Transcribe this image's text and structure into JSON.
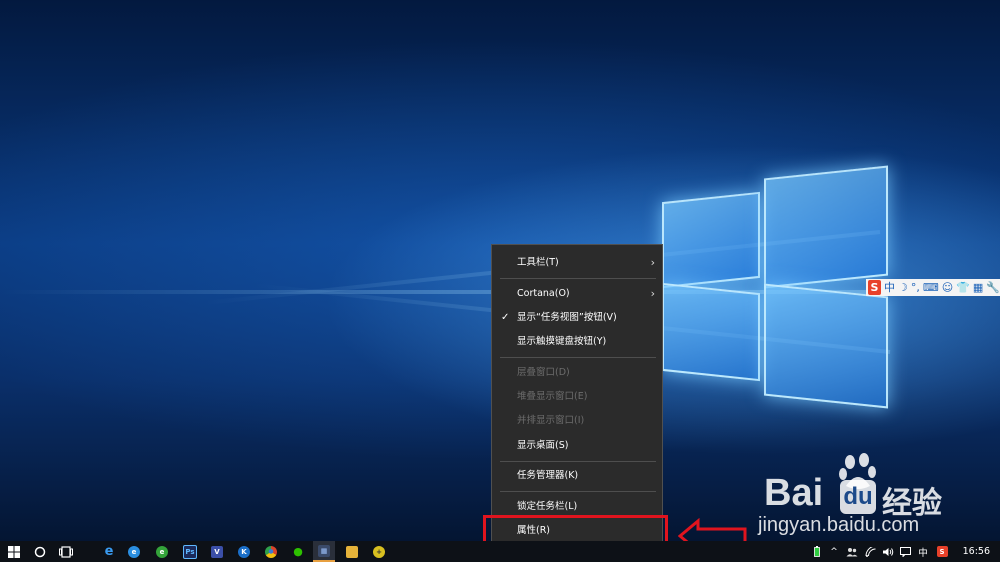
{
  "context_menu": {
    "items": [
      {
        "label": "工具栏(T)",
        "submenu": true,
        "enabled": true,
        "checked": false
      },
      {
        "label": "Cortana(O)",
        "submenu": true,
        "enabled": true,
        "checked": false
      },
      {
        "label": "显示“任务视图”按钮(V)",
        "submenu": false,
        "enabled": true,
        "checked": true
      },
      {
        "label": "显示触摸键盘按钮(Y)",
        "submenu": false,
        "enabled": true,
        "checked": false
      },
      {
        "label": "层叠窗口(D)",
        "submenu": false,
        "enabled": false,
        "checked": false
      },
      {
        "label": "堆叠显示窗口(E)",
        "submenu": false,
        "enabled": false,
        "checked": false
      },
      {
        "label": "并排显示窗口(I)",
        "submenu": false,
        "enabled": false,
        "checked": false
      },
      {
        "label": "显示桌面(S)",
        "submenu": false,
        "enabled": true,
        "checked": false
      },
      {
        "label": "任务管理器(K)",
        "submenu": false,
        "enabled": true,
        "checked": false
      },
      {
        "label": "锁定任务栏(L)",
        "submenu": false,
        "enabled": true,
        "checked": false
      },
      {
        "label": "属性(R)",
        "submenu": false,
        "enabled": true,
        "checked": false
      }
    ]
  },
  "ime_toolbar": {
    "logo": "S",
    "mode": "中"
  },
  "watermark": {
    "brand_left": "Bai",
    "brand_right": "经验",
    "url": "jingyan.baidu.com"
  },
  "taskbar": {
    "apps": [
      {
        "name": "edge",
        "glyph": "e",
        "color": "#1e78d7"
      },
      {
        "name": "360-browser",
        "glyph": "e",
        "color": "#2a8ee0"
      },
      {
        "name": "green-app",
        "glyph": "e",
        "color": "#34a33a"
      },
      {
        "name": "photoshop",
        "glyph": "Ps",
        "color": "#1b2a5a"
      },
      {
        "name": "visio",
        "glyph": "V",
        "color": "#3b4fa8"
      },
      {
        "name": "kugou",
        "glyph": "K",
        "color": "#1a6fc9"
      },
      {
        "name": "chrome",
        "glyph": "●",
        "color": "#d9452b"
      },
      {
        "name": "wechat",
        "glyph": "●",
        "color": "#2dc100"
      },
      {
        "name": "photo-viewer",
        "glyph": "▦",
        "color": "#3a4a6a"
      },
      {
        "name": "file-explorer",
        "glyph": "▬",
        "color": "#e6b33a"
      },
      {
        "name": "yellow-app",
        "glyph": "+",
        "color": "#d9c020"
      }
    ],
    "tray": {
      "ime_mode": "中",
      "sogou": "S",
      "time": "16:56"
    }
  },
  "colors": {
    "menu_bg": "#2b2b2b",
    "highlight": "#e0141e",
    "taskbar_bg": "#0d1117"
  }
}
